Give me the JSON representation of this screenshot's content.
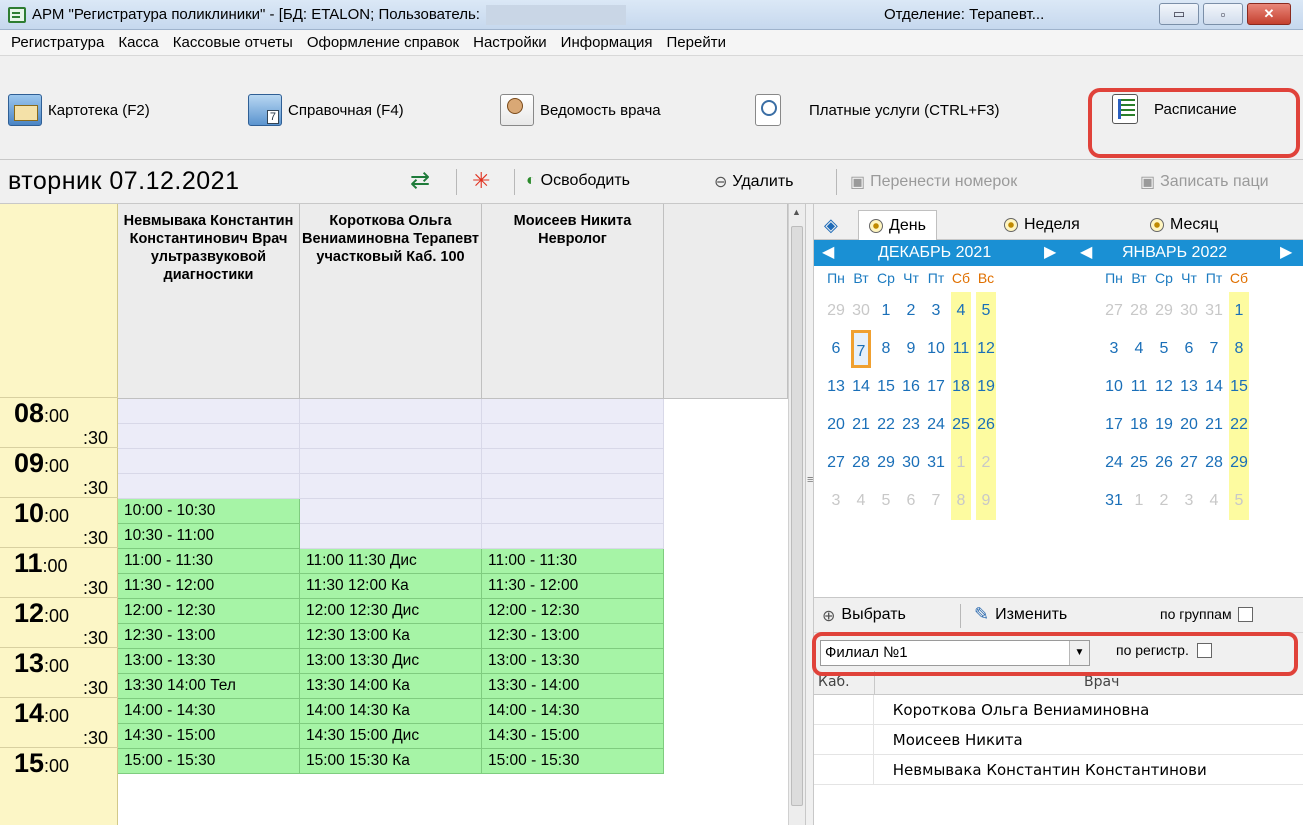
{
  "window": {
    "title": "АРМ \"Регистратура поликлиники\" - [БД: ETALON; Пользователь:",
    "department": "Отделение: Терапевт...",
    "btn_minimize": "▭",
    "btn_maximize": "▫",
    "btn_close": "✕"
  },
  "menu": [
    "Регистратура",
    "Касса",
    "Кассовые отчеты",
    "Оформление справок",
    "Настройки",
    "Информация",
    "Перейти"
  ],
  "toolbar": {
    "kartoteka": "Картотека (F2)",
    "spravochnaya": "Справочная (F4)",
    "vedomost": "Ведомость врача",
    "platnye": "Платные услуги (CTRL+F3)",
    "raspisanie": "Расписание"
  },
  "datebar": {
    "date": "вторник 07.12.2021",
    "refresh_icon": "⇄",
    "star_icon": "✳",
    "osvobodit": "Освободить",
    "udalit": "Удалить",
    "perenesti": "Перенести номерок",
    "zapisat": "Записать паци"
  },
  "doctors": [
    {
      "name": "Невмывака Константин Константинович Врач ультразвуковой диагностики"
    },
    {
      "name": "Короткова Ольга Вениаминовна Терапевт участковый Каб. 100"
    },
    {
      "name": "Моисеев Никита Невролог"
    }
  ],
  "time_labels": {
    "h08": "08",
    "h09": "09",
    "h10": "10",
    "h11": "11",
    "h12": "12",
    "h13": "13",
    "h14": "14",
    "h15": "15",
    "mins00": ":00",
    "mins30": ":30"
  },
  "slots": {
    "col1": [
      "",
      "",
      "",
      "",
      "10:00 - 10:30",
      "10:30 - 11:00",
      "11:00 - 11:30",
      "11:30 - 12:00",
      "12:00 - 12:30",
      "12:30 - 13:00",
      "13:00 - 13:30",
      "13:30 14:00 Тел",
      "14:00 - 14:30",
      "14:30 - 15:00",
      "15:00 - 15:30"
    ],
    "col2": [
      "",
      "",
      "",
      "",
      "",
      "",
      "11:00 11:30 Дис",
      "11:30 12:00  Ка",
      "12:00 12:30 Дис",
      "12:30 13:00  Ка",
      "13:00 13:30 Дис",
      "13:30 14:00  Ка",
      "14:00 14:30  Ка",
      "14:30 15:00 Дис",
      "15:00 15:30  Ка"
    ],
    "col3": [
      "",
      "",
      "",
      "",
      "",
      "",
      "11:00 - 11:30",
      "11:30 - 12:00",
      "12:00 - 12:30",
      "12:30 - 13:00",
      "13:00 - 13:30",
      "13:30 - 14:00",
      "14:00 - 14:30",
      "14:30 - 15:00",
      "15:00 - 15:30"
    ]
  },
  "view_tabs": {
    "day": "День",
    "week": "Неделя",
    "month": "Месяц"
  },
  "calendar": {
    "month1": "ДЕКАБРЬ 2021",
    "month2": "ЯНВАРЬ 2022",
    "weekdays": [
      "Пн",
      "Вт",
      "Ср",
      "Чт",
      "Пт",
      "Сб",
      "Вс"
    ],
    "weekdays2": [
      "Пн",
      "Вт",
      "Ср",
      "Чт",
      "Пт",
      "Сб"
    ],
    "dec": [
      [
        "29",
        "30",
        "1",
        "2",
        "3",
        "4",
        "5"
      ],
      [
        "6",
        "7",
        "8",
        "9",
        "10",
        "11",
        "12"
      ],
      [
        "13",
        "14",
        "15",
        "16",
        "17",
        "18",
        "19"
      ],
      [
        "20",
        "21",
        "22",
        "23",
        "24",
        "25",
        "26"
      ],
      [
        "27",
        "28",
        "29",
        "30",
        "31",
        "1",
        "2"
      ],
      [
        "3",
        "4",
        "5",
        "6",
        "7",
        "8",
        "9"
      ]
    ],
    "jan": [
      [
        "27",
        "28",
        "29",
        "30",
        "31",
        "1"
      ],
      [
        "3",
        "4",
        "5",
        "6",
        "7",
        "8"
      ],
      [
        "10",
        "11",
        "12",
        "13",
        "14",
        "15"
      ],
      [
        "17",
        "18",
        "19",
        "20",
        "21",
        "22"
      ],
      [
        "24",
        "25",
        "26",
        "27",
        "28",
        "29"
      ],
      [
        "31",
        "1",
        "2",
        "3",
        "4",
        "5"
      ]
    ],
    "selected_day": "7"
  },
  "panel": {
    "vybrat": "Выбрать",
    "izmenit": "Изменить",
    "po_gruppam": "по группам",
    "filial": "Филиал №1",
    "po_registr": "по регистр.",
    "col_kab": "Каб.",
    "col_vrach": "Врач"
  },
  "doctor_list": [
    "Короткова Ольга Вениаминовна",
    "Моисеев Никита",
    "Невмывака Константин Константинови"
  ]
}
